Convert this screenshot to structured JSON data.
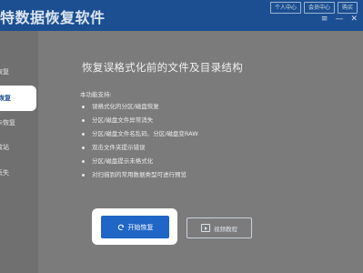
{
  "app": {
    "title": "特数据恢复软件"
  },
  "header": {
    "buttons": [
      "个人中心",
      "会员中心",
      "购买"
    ],
    "window_controls": [
      "≡",
      "—",
      "✕"
    ]
  },
  "sidebar": {
    "items": [
      {
        "label": "恢复",
        "active": false
      },
      {
        "label": "恢复",
        "active": true
      },
      {
        "label": "卡恢复",
        "active": false
      },
      {
        "label": "收站",
        "active": false
      },
      {
        "label": "丢失",
        "active": false
      }
    ]
  },
  "main": {
    "heading": "恢复误格式化前的文件及目录结构",
    "intro": "本功能支持:",
    "features": [
      "误格式化的分区/磁盘恢复",
      "分区/磁盘文件异常消失",
      "分区/磁盘文件名乱码、分区/磁盘变RAW",
      "双击文件夹提示错误",
      "分区/磁盘提示未格式化",
      "对扫描到的常用数据类型可进行预览"
    ],
    "start_button": "开始恢复",
    "video_button": "视频教程"
  },
  "colors": {
    "title_bar": "#1b4f91",
    "primary_button": "#1f66c7",
    "active_sidebar_text": "#1c4e8f"
  }
}
